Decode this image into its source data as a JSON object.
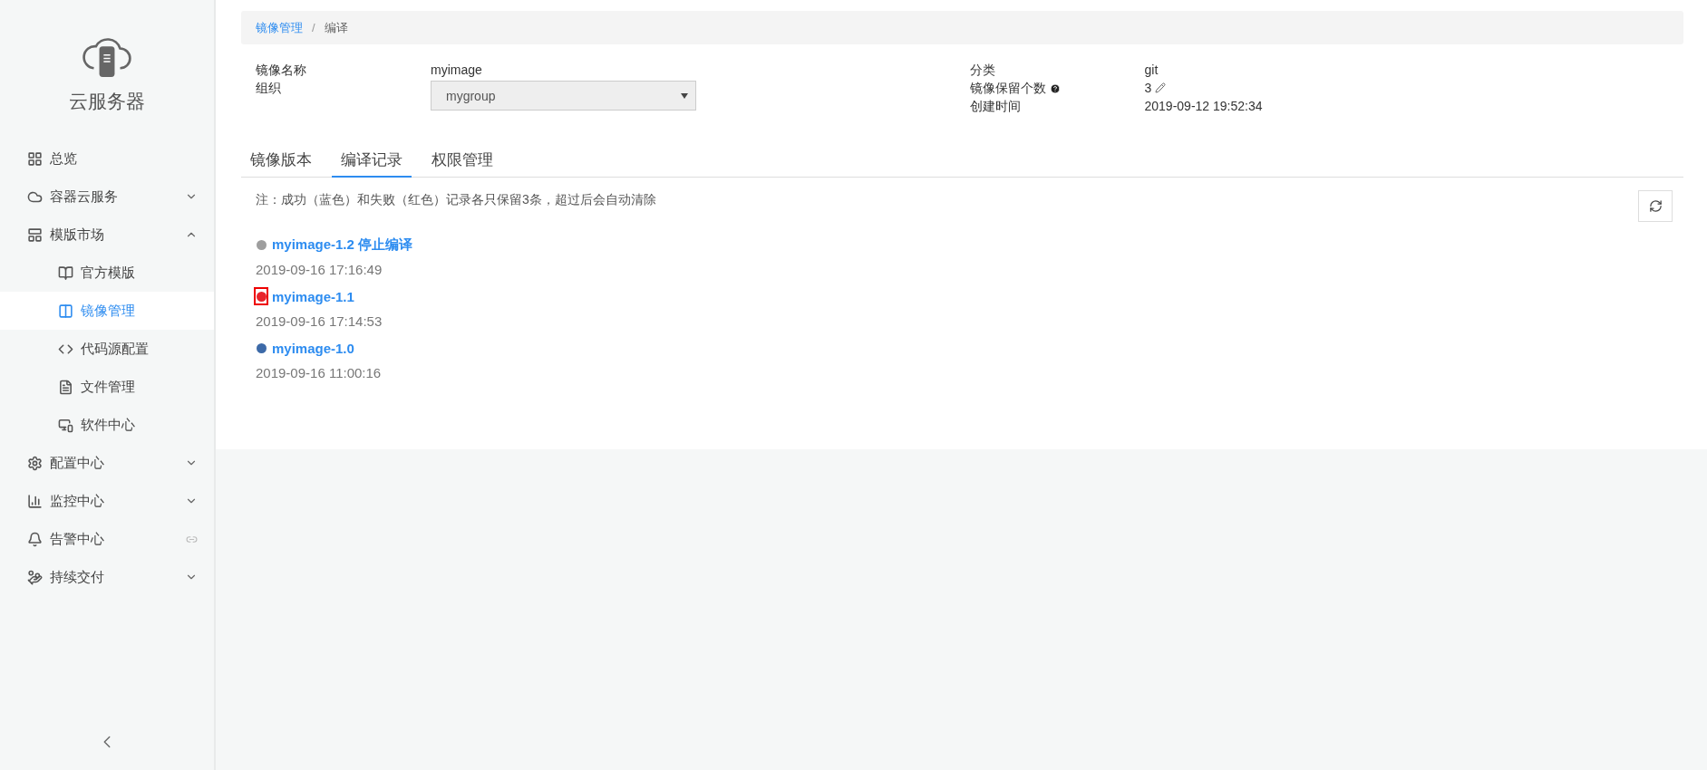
{
  "sidebar": {
    "title": "云服务器",
    "items": [
      {
        "label": "总览",
        "selected": false
      },
      {
        "label": "容器云服务",
        "expanded": false,
        "selected": false
      },
      {
        "label": "模版市场",
        "expanded": true,
        "selected": false,
        "children": [
          {
            "label": "官方模版",
            "selected": false
          },
          {
            "label": "镜像管理",
            "selected": true
          },
          {
            "label": "代码源配置",
            "selected": false
          },
          {
            "label": "文件管理",
            "selected": false
          },
          {
            "label": "软件中心",
            "selected": false
          }
        ]
      },
      {
        "label": "配置中心",
        "expanded": false,
        "selected": false
      },
      {
        "label": "监控中心",
        "expanded": false,
        "selected": false
      },
      {
        "label": "告警中心",
        "link": true,
        "selected": false
      },
      {
        "label": "持续交付",
        "expanded": false,
        "selected": false
      }
    ]
  },
  "breadcrumb": {
    "separator": "/",
    "items": [
      {
        "label": "镜像管理",
        "link": true
      },
      {
        "label": "编译",
        "link": false
      }
    ]
  },
  "info_left": [
    {
      "label": "镜像名称",
      "value": "myimage"
    },
    {
      "label": "组织",
      "select": "mygroup"
    }
  ],
  "info_right": [
    {
      "label": "分类",
      "value": "git"
    },
    {
      "label": "镜像保留个数",
      "value": "3",
      "help": true,
      "edit": true
    },
    {
      "label": "创建时间",
      "value": "2019-09-12 19:52:34"
    }
  ],
  "tabs": [
    {
      "label": "镜像版本",
      "selected": false
    },
    {
      "label": "编译记录",
      "selected": true
    },
    {
      "label": "权限管理",
      "selected": false
    }
  ],
  "note": "注：成功（蓝色）和失败（红色）记录各只保留3条，超过后会自动清除",
  "records": [
    {
      "name": "myimage-1.2 停止编译",
      "time": "2019-09-16 17:16:49",
      "color": "#9e9e9e",
      "highlighted": false
    },
    {
      "name": "myimage-1.1",
      "time": "2019-09-16 17:14:53",
      "color": "#e8242b",
      "highlighted": true
    },
    {
      "name": "myimage-1.0",
      "time": "2019-09-16 11:00:16",
      "color": "#3d6aa8",
      "highlighted": false
    }
  ]
}
